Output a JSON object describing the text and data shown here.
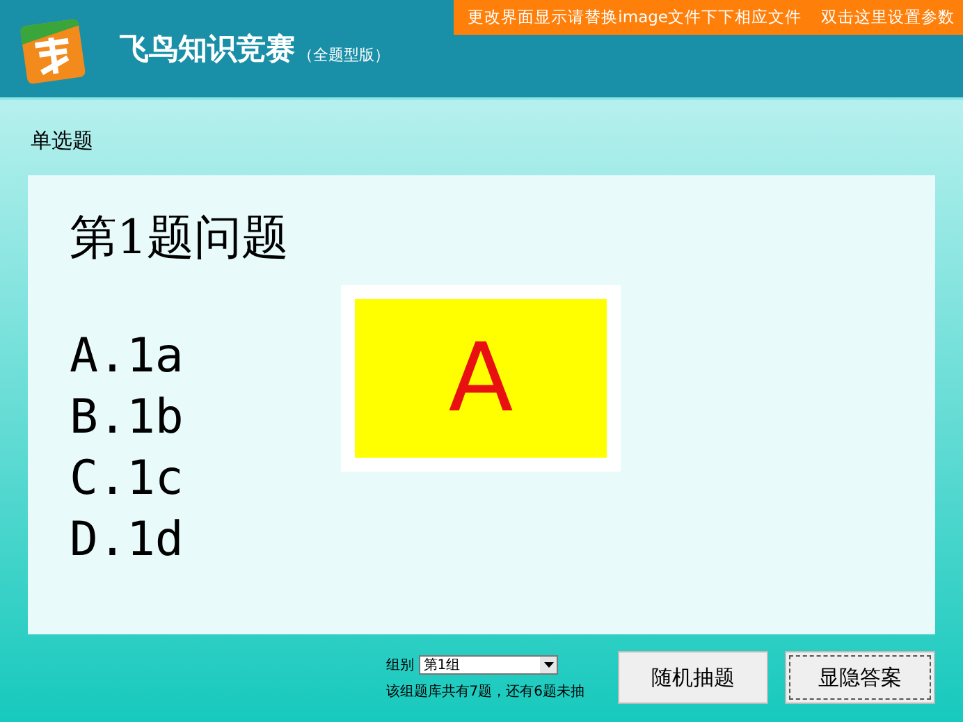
{
  "header": {
    "title": "飞鸟知识竞赛",
    "subtitle": "（全题型版）",
    "notice": "更改界面显示请替换image文件下下相应文件",
    "settings_link": "双击这里设置参数"
  },
  "question_type": "单选题",
  "question": {
    "title": "第1题问题",
    "options": [
      "A.1a",
      "B.1b",
      "C.1c",
      "D.1d"
    ]
  },
  "answer": {
    "text": "A",
    "shown": true
  },
  "group": {
    "label": "组别",
    "value": "第1组",
    "note": "该组题库共有7题，还有6题未抽"
  },
  "buttons": [
    "随机抽题",
    "显隐答案"
  ]
}
